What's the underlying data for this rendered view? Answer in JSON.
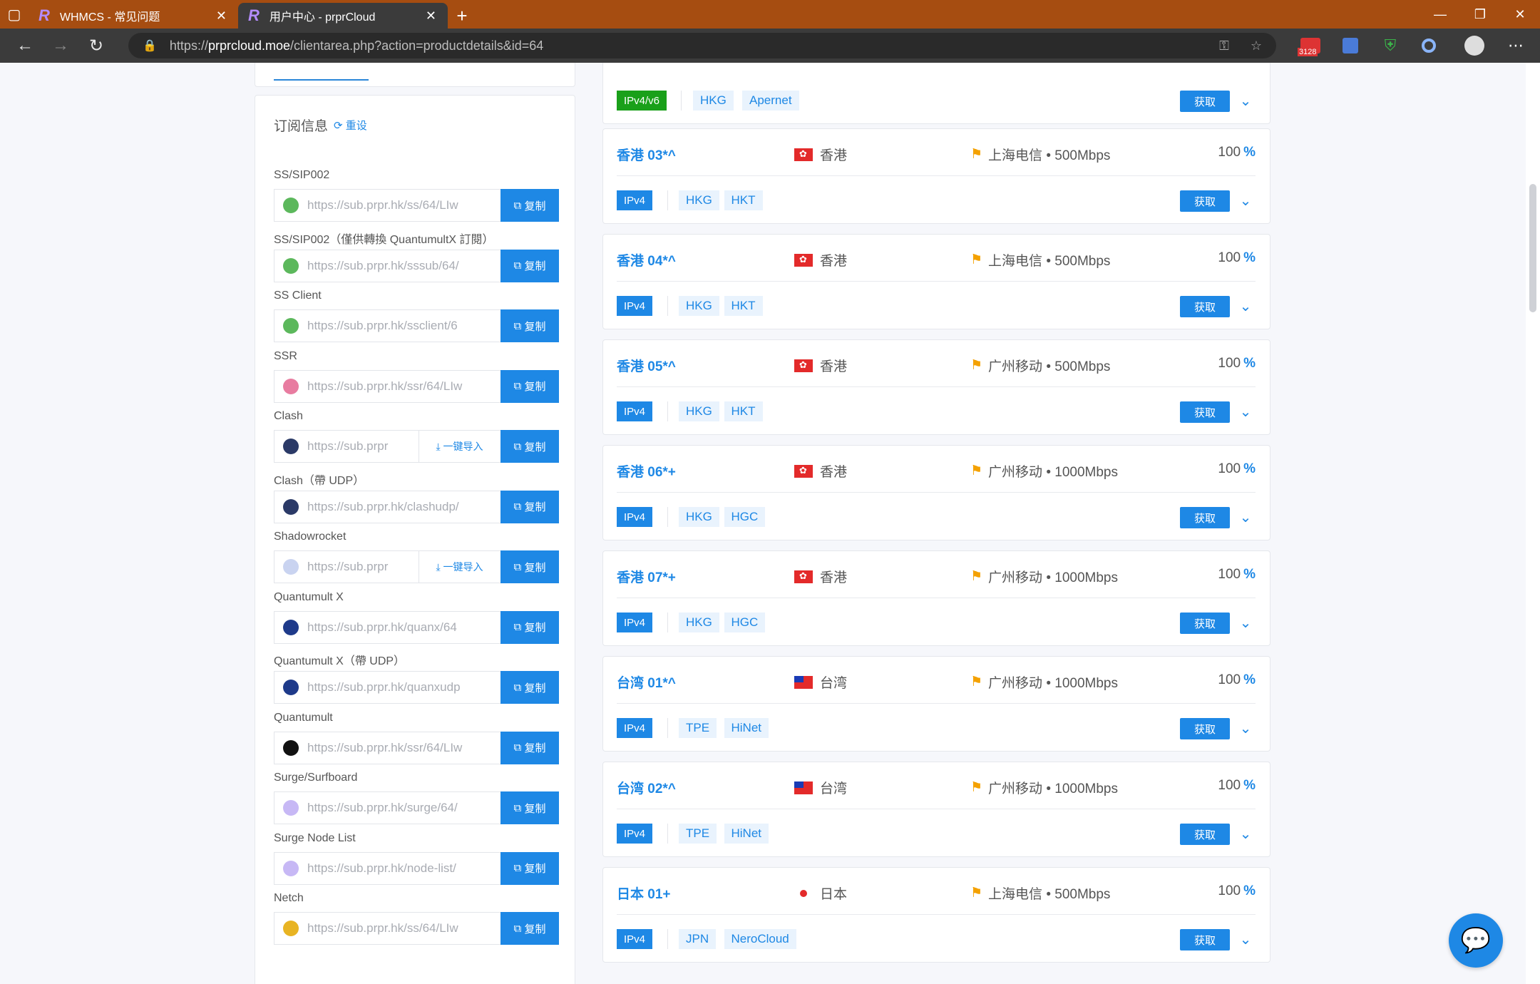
{
  "browser": {
    "tabs": [
      {
        "logo": "R",
        "title": "WHMCS - 常见问题"
      },
      {
        "logo": "R",
        "title": "用户中心 - prprCloud"
      }
    ],
    "url_prefix": "https://",
    "url_host": "prprcloud.moe",
    "url_path": "/clientarea.php?action=productdetails&id=64",
    "ext_badge": "3128"
  },
  "subscription": {
    "title": "订阅信息",
    "reset_label": "重设",
    "copy_label": "复制",
    "import_label": "一键导入",
    "items": [
      {
        "label": "SS/SIP002",
        "url": "https://sub.prpr.hk/ss/64/LIw",
        "icon_color": "#5cb85c",
        "import": false
      },
      {
        "label": "SS/SIP002（僅供轉換 QuantumultX 訂閱）",
        "url": "https://sub.prpr.hk/sssub/64/",
        "icon_color": "#5cb85c",
        "import": false
      },
      {
        "label": "SS Client",
        "url": "https://sub.prpr.hk/ssclient/6",
        "icon_color": "#5cb85c",
        "import": false
      },
      {
        "label": "SSR",
        "url": "https://sub.prpr.hk/ssr/64/LIw",
        "icon_color": "#e87ca0",
        "import": false
      },
      {
        "label": "Clash",
        "url": "https://sub.prpr",
        "icon_color": "#2b3a67",
        "import": true
      },
      {
        "label": "Clash（帶 UDP）",
        "url": "https://sub.prpr.hk/clashudp/",
        "icon_color": "#2b3a67",
        "import": false
      },
      {
        "label": "Shadowrocket",
        "url": "https://sub.prpr",
        "icon_color": "#c9d3f0",
        "import": true
      },
      {
        "label": "Quantumult X",
        "url": "https://sub.prpr.hk/quanx/64",
        "icon_color": "#1e3a8a",
        "import": false
      },
      {
        "label": "Quantumult X（帶 UDP）",
        "url": "https://sub.prpr.hk/quanxudp",
        "icon_color": "#1e3a8a",
        "import": false
      },
      {
        "label": "Quantumult",
        "url": "https://sub.prpr.hk/ssr/64/LIw",
        "icon_color": "#111111",
        "import": false
      },
      {
        "label": "Surge/Surfboard",
        "url": "https://sub.prpr.hk/surge/64/",
        "icon_color": "#c7b8f5",
        "import": false
      },
      {
        "label": "Surge Node List",
        "url": "https://sub.prpr.hk/node-list/",
        "icon_color": "#c7b8f5",
        "import": false
      },
      {
        "label": "Netch",
        "url": "https://sub.prpr.hk/ss/64/LIw",
        "icon_color": "#e8b423",
        "import": false
      }
    ]
  },
  "nodes": {
    "get_label": "获取",
    "pct_suffix": "%",
    "top_partial": {
      "badge": "IPv4/v6",
      "tags": [
        "HKG",
        "Apernet"
      ]
    },
    "items": [
      {
        "name": "香港 03*^",
        "flag": "hk",
        "region": "香港",
        "line": "上海电信 • 500Mbps",
        "pct": "100",
        "badge": "IPv4",
        "tags": [
          "HKG",
          "HKT"
        ]
      },
      {
        "name": "香港 04*^",
        "flag": "hk",
        "region": "香港",
        "line": "上海电信 • 500Mbps",
        "pct": "100",
        "badge": "IPv4",
        "tags": [
          "HKG",
          "HKT"
        ]
      },
      {
        "name": "香港 05*^",
        "flag": "hk",
        "region": "香港",
        "line": "广州移动 • 500Mbps",
        "pct": "100",
        "badge": "IPv4",
        "tags": [
          "HKG",
          "HKT"
        ]
      },
      {
        "name": "香港 06*+",
        "flag": "hk",
        "region": "香港",
        "line": "广州移动 • 1000Mbps",
        "pct": "100",
        "badge": "IPv4",
        "tags": [
          "HKG",
          "HGC"
        ]
      },
      {
        "name": "香港 07*+",
        "flag": "hk",
        "region": "香港",
        "line": "广州移动 • 1000Mbps",
        "pct": "100",
        "badge": "IPv4",
        "tags": [
          "HKG",
          "HGC"
        ]
      },
      {
        "name": "台湾 01*^",
        "flag": "tw",
        "region": "台湾",
        "line": "广州移动 • 1000Mbps",
        "pct": "100",
        "badge": "IPv4",
        "tags": [
          "TPE",
          "HiNet"
        ]
      },
      {
        "name": "台湾 02*^",
        "flag": "tw",
        "region": "台湾",
        "line": "广州移动 • 1000Mbps",
        "pct": "100",
        "badge": "IPv4",
        "tags": [
          "TPE",
          "HiNet"
        ]
      },
      {
        "name": "日本 01+",
        "flag": "jp",
        "region": "日本",
        "line": "上海电信 • 500Mbps",
        "pct": "100",
        "badge": "IPv4",
        "tags": [
          "JPN",
          "NeroCloud"
        ]
      }
    ]
  }
}
